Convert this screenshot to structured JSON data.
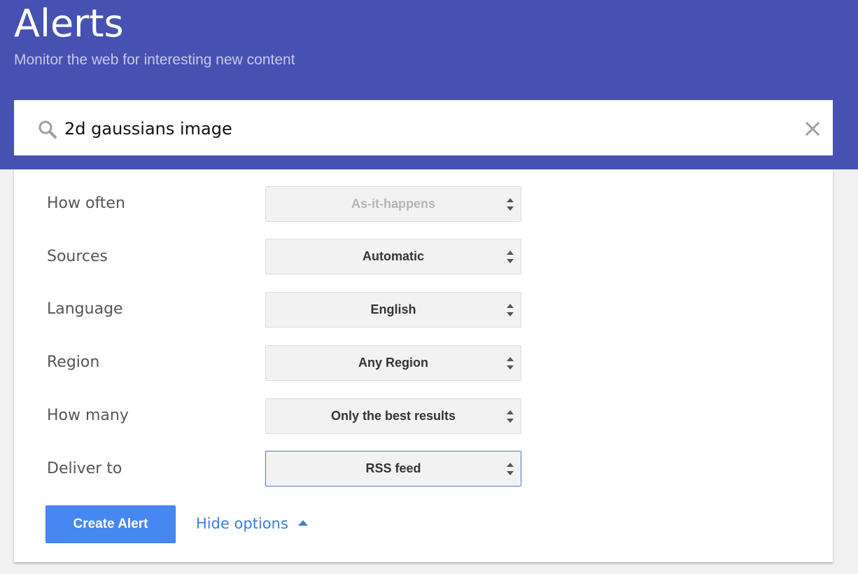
{
  "header": {
    "title": "Alerts",
    "subtitle": "Monitor the web for interesting new content"
  },
  "search": {
    "query": "2d gaussians image",
    "search_icon": "search-icon",
    "clear_icon": "close-icon"
  },
  "options": [
    {
      "label": "How often",
      "value": "As-it-happens",
      "state": "disabled"
    },
    {
      "label": "Sources",
      "value": "Automatic",
      "state": "normal"
    },
    {
      "label": "Language",
      "value": "English",
      "state": "normal"
    },
    {
      "label": "Region",
      "value": "Any Region",
      "state": "normal"
    },
    {
      "label": "How many",
      "value": "Only the best results",
      "state": "normal"
    },
    {
      "label": "Deliver to",
      "value": "RSS feed",
      "state": "focused"
    }
  ],
  "actions": {
    "create_label": "Create Alert",
    "hide_options_label": "Hide options"
  },
  "colors": {
    "header_bg": "#4751b1",
    "accent_blue": "#4687f2",
    "link_blue": "#3e7ce0"
  }
}
